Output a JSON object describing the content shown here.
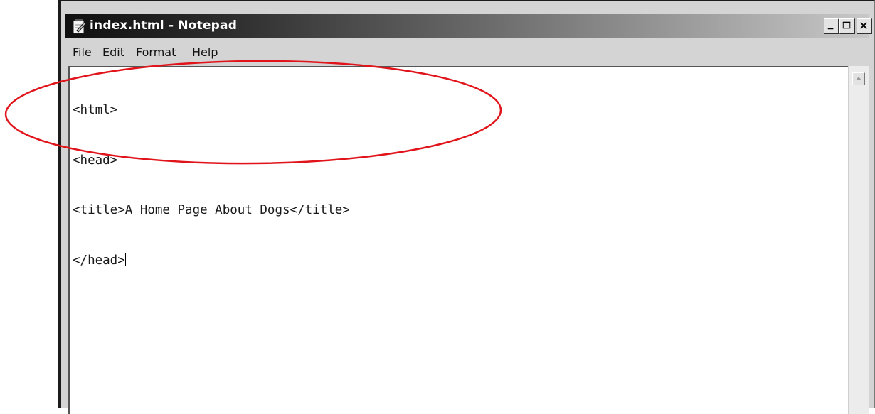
{
  "window": {
    "title": "index.html - Notepad",
    "controls": [
      "minimize",
      "maximize",
      "close"
    ]
  },
  "menu": {
    "file": "File",
    "edit": "Edit",
    "format": "Format",
    "help": "Help"
  },
  "editor": {
    "lines": [
      "<html>",
      "<head>",
      "<title>A Home Page About Dogs</title>",
      "</head>"
    ]
  },
  "annotation": {
    "shape": "ellipse",
    "color": "#e0141a"
  },
  "icons": {
    "app": "notepad-icon",
    "minimize": "minimize-icon",
    "maximize": "maximize-icon",
    "close": "close-icon",
    "scroll_up": "scroll-up-arrow-icon"
  }
}
